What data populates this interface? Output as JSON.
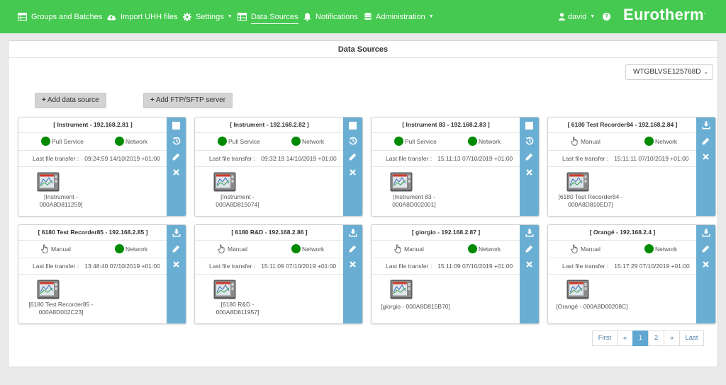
{
  "nav": {
    "items": [
      {
        "label": "Groups and Batches",
        "icon": "table-icon"
      },
      {
        "label": "Import UHH files",
        "icon": "cloud-upload-icon"
      },
      {
        "label": "Settings",
        "icon": "gear-icon"
      },
      {
        "label": "Data Sources",
        "icon": "table-icon"
      },
      {
        "label": "Notifications",
        "icon": "bell-icon"
      },
      {
        "label": "Administration",
        "icon": "database-icon"
      }
    ],
    "user": "david",
    "help": "?",
    "brand": "Eurotherm",
    "brand_mark": "."
  },
  "page": {
    "title": "Data Sources",
    "server": "WTGBLVSE125768D",
    "add_source_label": "Add data source",
    "add_ftp_label": "Add FTP/SFTP server",
    "transfer_label": "Last file transfer :"
  },
  "cards": [
    {
      "title": "[ Instrument - 192.168.2.81 ]",
      "mode": "Pull Service",
      "net": "Network",
      "time": "09:24:59 14/10/2019 +01:00",
      "device": [
        "[Instrument -",
        "000A8D811259]"
      ]
    },
    {
      "title": "[ Instrument - 192.168.2.82 ]",
      "mode": "Pull Service",
      "net": "Network",
      "time": "09:32:19 14/10/2019 +01:00",
      "device": [
        "[Instrument -",
        "000A8D815074]"
      ]
    },
    {
      "title": "[ Instrument 83 - 192.168.2.83 ]",
      "mode": "Pull Service",
      "net": "Network",
      "time": "15:11:13 07/10/2019 +01:00",
      "device": [
        "[Instrument 83 -",
        "000A8D002001]"
      ]
    },
    {
      "title": "[ 6180 Test Recorder84 - 192.168.2.84 ]",
      "mode": "Manual",
      "net": "Network",
      "time": "15:11:11 07/10/2019 +01:00",
      "device": [
        "[6180 Test Recorder84 -",
        "000A8D810ED7]"
      ]
    },
    {
      "title": "[ 6180 Test Recorder85 - 192.168.2.85 ]",
      "mode": "Manual",
      "net": "Network",
      "time": "13:48:40 07/10/2019 +01:00",
      "device": [
        "[6180 Test Recorder85 -",
        "000A8D002C23]"
      ]
    },
    {
      "title": "[ 6180 R&D - 192.168.2.86 ]",
      "mode": "Manual",
      "net": "Network",
      "time": "15:11:09 07/10/2019 +01:00",
      "device": [
        "[6180 R&D -",
        "000A8D811957]"
      ]
    },
    {
      "title": "[ giorgio - 192.168.2.87 ]",
      "mode": "Manual",
      "net": "Network",
      "time": "15:11:09 07/10/2019 +01:00",
      "device": [
        "[giorgio - 000A8D815B70]"
      ]
    },
    {
      "title": "[ Orangé - 192.168.2.4 ]",
      "mode": "Manual",
      "net": "Network",
      "time": "15:17:29 07/10/2019 +01:00",
      "device": [
        "[Orangé - 000A8D00208C]"
      ]
    }
  ],
  "pagination": [
    "First",
    "«",
    "1",
    "2",
    "»",
    "Last"
  ],
  "colors": {
    "navbar": "#45c950",
    "actions": "#6aafd3",
    "led": "#008a00",
    "active_page": "#5fa7d1"
  }
}
